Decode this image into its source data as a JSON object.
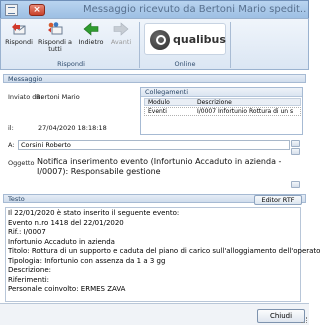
{
  "window": {
    "title": "Messaggio ricevuto da Bertoni Mario spedit..."
  },
  "ribbon": {
    "buttons": [
      {
        "label": "Rispondi",
        "icon": "reply-icon"
      },
      {
        "label": "Rispondi a tutti",
        "icon": "reply-all-icon"
      },
      {
        "label": "Indietro",
        "icon": "back-arrow-icon"
      },
      {
        "label": "Avanti",
        "icon": "forward-arrow-icon",
        "disabled": true
      }
    ],
    "group_rispondi": "Rispondi",
    "group_online": "Online",
    "brand": "qualibus"
  },
  "messaggio": {
    "section_title": "Messaggio",
    "sender_label": "Inviato da:",
    "sender": "Bertoni Mario",
    "date_label": "il:",
    "date": "27/04/2020 18:18:18",
    "to_label": "A:",
    "to": "Corsini Roberto",
    "subject_label": "Oggetto",
    "subject": "Notifica inserimento evento (Infortunio Accaduto in azienda - I/0007): Responsabile gestione"
  },
  "collegamenti": {
    "title": "Collegamenti",
    "columns": [
      "Modulo",
      "Descrizione"
    ],
    "rows": [
      {
        "modulo": "Eventi",
        "descrizione": "I/0007 Infortunio Rottura di un s"
      }
    ]
  },
  "testo": {
    "section_title": "Testo",
    "editor_button": "Editor RTF",
    "lines": [
      "Il 22/01/2020 è stato inserito il seguente evento:",
      "Evento n.ro 1418 del 22/01/2020",
      "Rif.: I/0007",
      "Infortunio Accaduto in azienda",
      "Titolo: Rottura di un supporto e caduta del piano di carico sull'alloggiamento dell'operatore",
      "Tipologia: Infortunio con assenza da 1 a 3 gg",
      "Descrizione:",
      "Riferimenti:",
      "Personale coinvolto: ERMES ZAVA"
    ]
  },
  "footer": {
    "close_button": "Chiudi"
  },
  "colors": {
    "titlebar": "#b9d4f0",
    "ribbon": "#dbe6f3",
    "section_header": "#cfdcec"
  }
}
